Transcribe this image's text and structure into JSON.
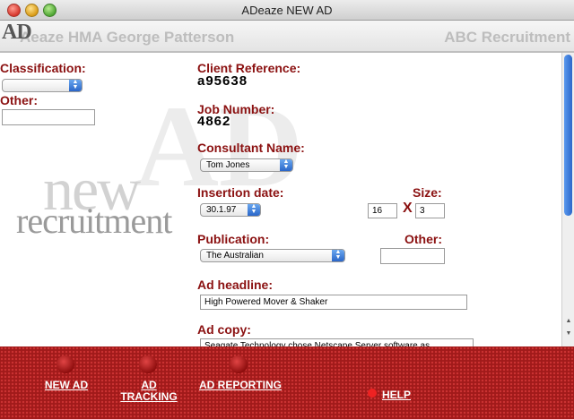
{
  "window": {
    "title": "ADeaze NEW AD"
  },
  "header": {
    "logo": "AD",
    "left_text": "Aeaze HMA George Patterson",
    "right_text": "ABC Recruitment"
  },
  "watermark": {
    "big": "AD",
    "new": "new",
    "recruitment": "recruitment"
  },
  "form": {
    "classification_label": "Classification:",
    "classification_value": "",
    "other_label": "Other:",
    "other_value": "",
    "client_reference_label": "Client Reference:",
    "client_reference_value": "a95638",
    "job_number_label": "Job Number:",
    "job_number_value": "4862",
    "consultant_label": "Consultant Name:",
    "consultant_value": "Tom Jones",
    "insertion_label": "Insertion date:",
    "insertion_value": "30.1.97",
    "size_label": "Size:",
    "size_width": "16",
    "size_x": "X",
    "size_height": "3",
    "publication_label": "Publication:",
    "publication_value": "The Australian",
    "pub_other_label": "Other:",
    "pub_other_value": "",
    "headline_label": "Ad headline:",
    "headline_value": "High Powered Mover & Shaker",
    "copy_label": "Ad copy:",
    "copy_value": "Seagate Technology chose Netscape Server software as"
  },
  "footer": {
    "new_ad": "NEW AD",
    "ad_tracking_1": "AD",
    "ad_tracking_2": "TRACKING",
    "ad_reporting": "AD REPORTING",
    "help": "HELP"
  },
  "icons": {
    "popup_arrows": "updown-arrows-icon",
    "scroll_up": "scroll-up-arrow-icon",
    "scroll_down": "scroll-down-arrow-icon",
    "nav_ball": "red-ball-icon"
  },
  "colors": {
    "label": "#8b1111",
    "footer": "#a11a1a",
    "accent": "#2a66c8"
  }
}
